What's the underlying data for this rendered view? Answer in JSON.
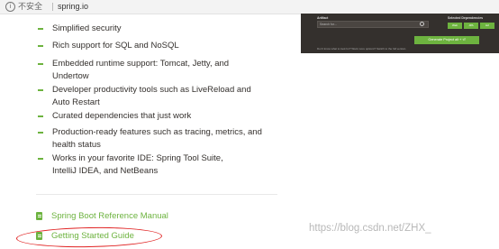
{
  "browser": {
    "info_icon": "info-icon",
    "security_label": "不安全",
    "url": "spring.io"
  },
  "features": [
    "Simplified security",
    "Rich support for SQL and NoSQL",
    "Embedded runtime support: Tomcat, Jetty, and",
    "Undertow",
    "Developer productivity tools such as LiveReload and",
    "Auto Restart",
    "Curated dependencies that just work",
    "Production-ready features such as tracing, metrics, and",
    "health status",
    "Works in your favorite IDE: Spring Tool Suite,",
    "IntelliJ IDEA, and NetBeans"
  ],
  "links": {
    "reference_manual": "Spring Boot Reference Manual",
    "getting_started": "Getting Started Guide",
    "link_icon": "document-icon"
  },
  "initializr": {
    "artifact_label": "Artifact",
    "artifact_value": "Search for...",
    "deps_label": "Selected Dependencies",
    "chips": [
      "Web",
      "JPA",
      "H2"
    ],
    "generate_label": "Generate Project  alt + ⏎",
    "hint": "Don't know what to look for? Want more options? Switch to the full version."
  },
  "watermark": "https://blog.csdn.net/ZHX_",
  "colors": {
    "accent": "#6db33f",
    "text": "#34302d",
    "highlight": "#e02020",
    "panel": "#34302d"
  }
}
